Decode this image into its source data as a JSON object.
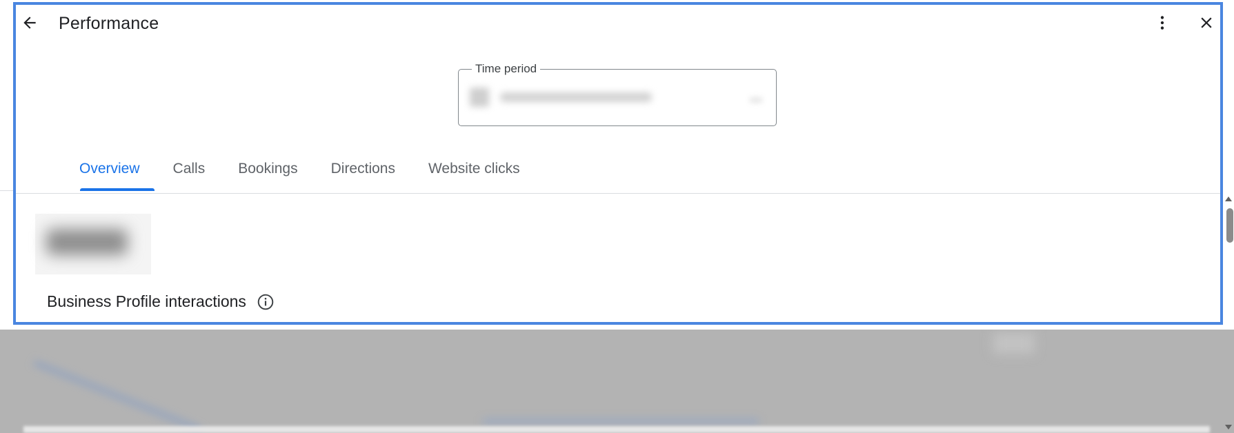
{
  "dialog": {
    "title": "Performance",
    "icons": {
      "back": "arrow-left-icon",
      "more": "more-vert-icon",
      "close": "close-icon"
    }
  },
  "time_period": {
    "label": "Time period",
    "value_redacted": true
  },
  "tabs": [
    {
      "label": "Overview",
      "active": true
    },
    {
      "label": "Calls",
      "active": false
    },
    {
      "label": "Bookings",
      "active": false
    },
    {
      "label": "Directions",
      "active": false
    },
    {
      "label": "Website clicks",
      "active": false
    }
  ],
  "summary": {
    "metric_redacted": true,
    "label": "Business Profile interactions",
    "info_icon": "info-icon"
  },
  "colors": {
    "accent": "#1a73e8",
    "focus_border": "#4a86e0",
    "overlay": "#b3b3b3",
    "text": "#202124",
    "muted_text": "#5f6368"
  }
}
